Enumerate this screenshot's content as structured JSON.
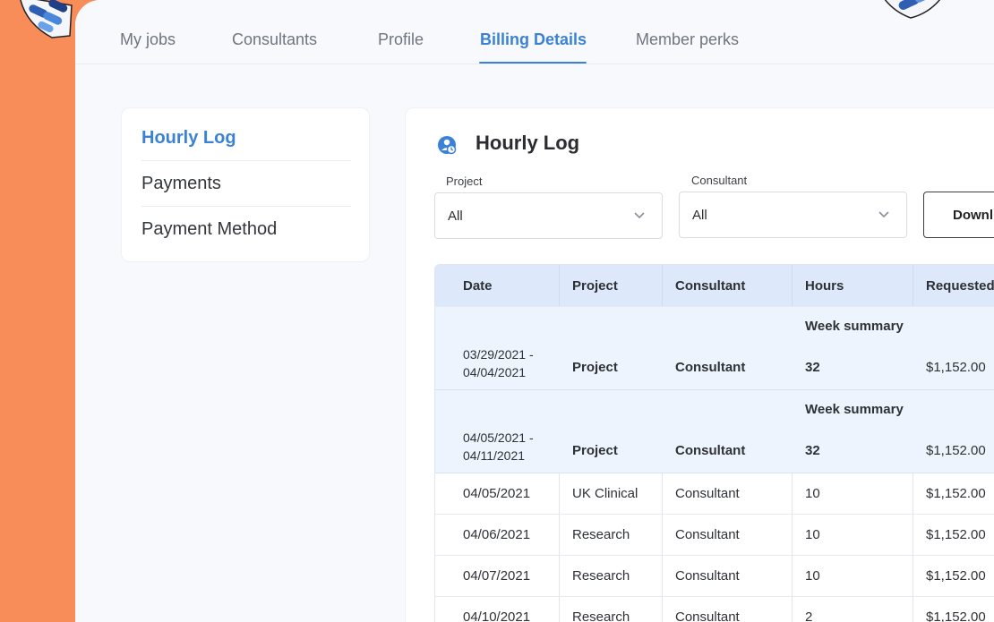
{
  "nav": {
    "tabs": [
      {
        "label": "My jobs",
        "active": false
      },
      {
        "label": "Consultants",
        "active": false
      },
      {
        "label": "Profile",
        "active": false
      },
      {
        "label": "Billing Details",
        "active": true
      },
      {
        "label": "Member perks",
        "active": false
      }
    ]
  },
  "sidebar": {
    "items": [
      {
        "label": "Hourly Log",
        "active": true
      },
      {
        "label": "Payments",
        "active": false
      },
      {
        "label": "Payment Method",
        "active": false
      }
    ]
  },
  "main": {
    "title": "Hourly Log",
    "title_icon": "clock-user-icon",
    "filters": {
      "project": {
        "label": "Project",
        "value": "All"
      },
      "consultant": {
        "label": "Consultant",
        "value": "All"
      }
    },
    "download_label": "Downl"
  },
  "table": {
    "headers": [
      "Date",
      "Project",
      "Consultant",
      "Hours",
      "Requested"
    ],
    "week_rows": [
      {
        "summary_label": "Week summary",
        "date_range_start": "03/29/2021 -",
        "date_range_end": "04/04/2021",
        "project": "Project",
        "consultant": "Consultant",
        "hours": "32",
        "requested": "$1,152.00"
      },
      {
        "summary_label": "Week summary",
        "date_range_start": "04/05/2021 -",
        "date_range_end": "04/11/2021",
        "project": "Project",
        "consultant": "Consultant",
        "hours": "32",
        "requested": "$1,152.00"
      }
    ],
    "day_rows": [
      {
        "date": "04/05/2021",
        "project": "UK Clinical",
        "consultant": "Consultant",
        "hours": "10",
        "requested": "$1,152.00"
      },
      {
        "date": "04/06/2021",
        "project": "Research",
        "consultant": "Consultant",
        "hours": "10",
        "requested": "$1,152.00"
      },
      {
        "date": "04/07/2021",
        "project": "Research",
        "consultant": "Consultant",
        "hours": "10",
        "requested": "$1,152.00"
      },
      {
        "date": "04/10/2021",
        "project": "Research",
        "consultant": "Consultant",
        "hours": "2",
        "requested": "$1,152.00"
      }
    ]
  },
  "colors": {
    "accent": "#3b82d6",
    "background_orange": "#f98d5a",
    "header_row": "#dde9fb",
    "week_row": "#eef4fd"
  }
}
